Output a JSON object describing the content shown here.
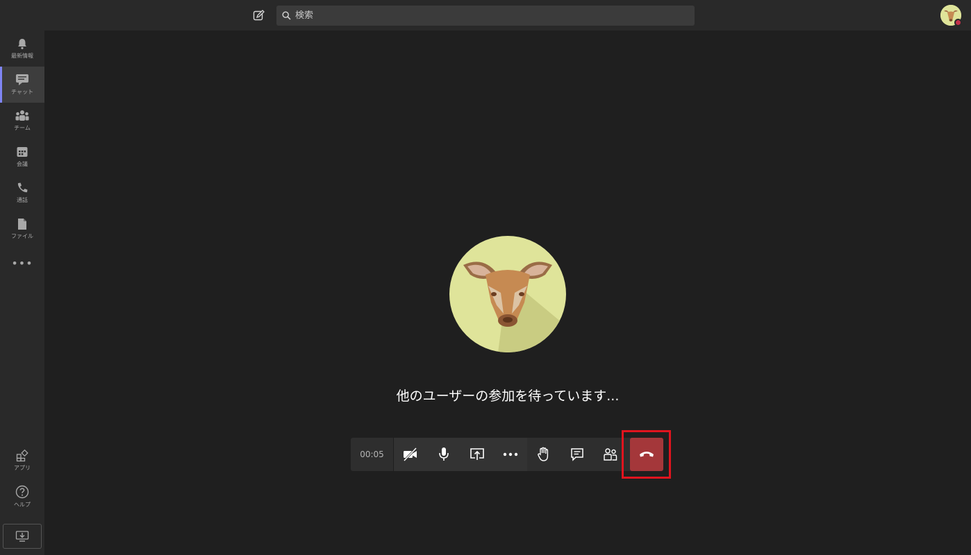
{
  "search": {
    "placeholder": "検索"
  },
  "rail": {
    "items": [
      {
        "label": "最新情報",
        "icon": "bell-icon"
      },
      {
        "label": "チャット",
        "icon": "chat-icon",
        "active": true
      },
      {
        "label": "チーム",
        "icon": "teams-icon"
      },
      {
        "label": "会議",
        "icon": "calendar-icon"
      },
      {
        "label": "通話",
        "icon": "phone-icon"
      },
      {
        "label": "ファイル",
        "icon": "file-icon"
      }
    ],
    "more": "•••",
    "bottom": [
      {
        "label": "アプリ",
        "icon": "apps-icon"
      },
      {
        "label": "ヘルプ",
        "icon": "help-icon"
      }
    ]
  },
  "call": {
    "status_text": "他のユーザーの参加を待っています...",
    "timer": "00:05"
  },
  "colors": {
    "accent": "#7f85f5",
    "hangup": "#a4373a",
    "highlight": "#e0141e",
    "avatar_bg": "#dfe49a"
  }
}
